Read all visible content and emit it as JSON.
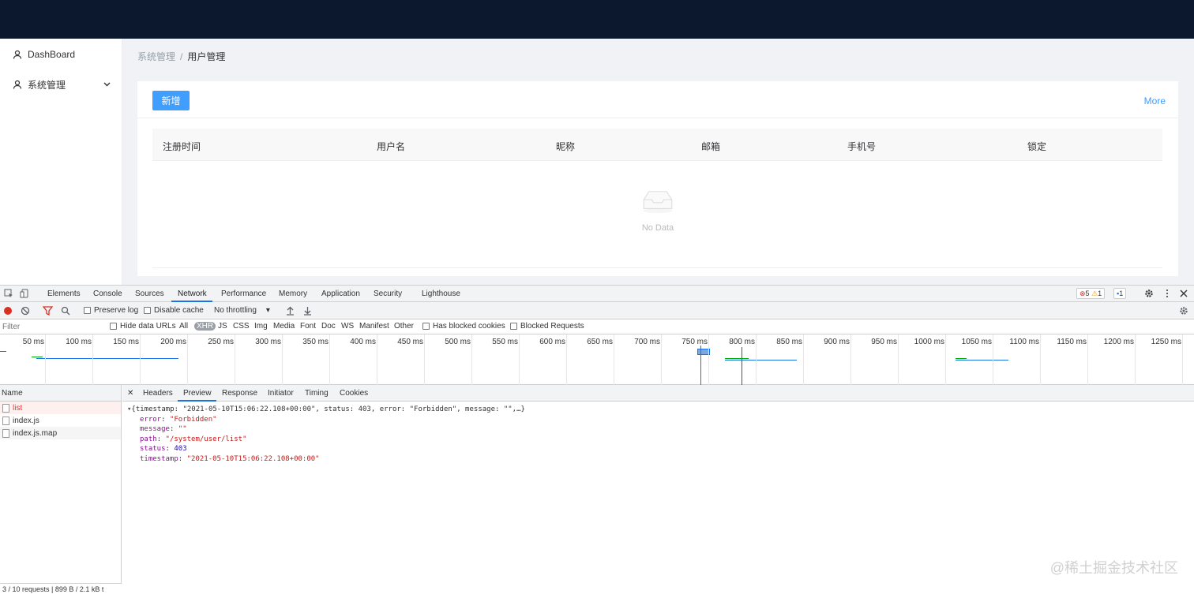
{
  "sidebar": {
    "items": [
      {
        "label": "DashBoard",
        "icon": "user-icon"
      },
      {
        "label": "系统管理",
        "icon": "user-icon",
        "chevron": "chevron-down-icon"
      }
    ]
  },
  "breadcrumb": {
    "parent": "系统管理",
    "separator": "/",
    "current": "用户管理"
  },
  "card": {
    "add_button": "新增",
    "more_link": "More",
    "columns": [
      "注册时间",
      "用户名",
      "昵称",
      "邮箱",
      "手机号",
      "锁定"
    ],
    "empty_text": "No Data"
  },
  "devtools": {
    "tabs": [
      "Elements",
      "Console",
      "Sources",
      "Network",
      "Performance",
      "Memory",
      "Application",
      "Security",
      "Lighthouse"
    ],
    "active_tab": "Network",
    "badges": {
      "errors": "5",
      "warnings": "1",
      "messages": "1"
    },
    "toolbar": {
      "preserve_log": "Preserve log",
      "disable_cache": "Disable cache",
      "throttling": "No throttling"
    },
    "filter": {
      "placeholder": "Filter",
      "hide_data_urls": "Hide data URLs",
      "types": [
        "All",
        "XHR",
        "JS",
        "CSS",
        "Img",
        "Media",
        "Font",
        "Doc",
        "WS",
        "Manifest",
        "Other"
      ],
      "selected_type": "XHR",
      "blocked_cookies": "Has blocked cookies",
      "blocked_requests": "Blocked Requests"
    },
    "timeline_ticks": [
      "50 ms",
      "100 ms",
      "150 ms",
      "200 ms",
      "250 ms",
      "300 ms",
      "350 ms",
      "400 ms",
      "450 ms",
      "500 ms",
      "550 ms",
      "600 ms",
      "650 ms",
      "700 ms",
      "750 ms",
      "800 ms",
      "850 ms",
      "900 ms",
      "950 ms",
      "1000 ms",
      "1050 ms",
      "1100 ms",
      "1150 ms",
      "1200 ms",
      "1250 ms"
    ],
    "requests_header": "Name",
    "requests": [
      "list",
      "index.js",
      "index.js.map"
    ],
    "status_bar": "3 / 10 requests | 899 B / 2.1 kB t",
    "detail_tabs": [
      "Headers",
      "Preview",
      "Response",
      "Initiator",
      "Timing",
      "Cookies"
    ],
    "active_detail_tab": "Preview",
    "preview": {
      "summary": "{timestamp: \"2021-05-10T15:06:22.108+00:00\", status: 403, error: \"Forbidden\", message: \"\",…}",
      "fields": [
        {
          "key": "error",
          "value": "\"Forbidden\"",
          "kind": "str"
        },
        {
          "key": "message",
          "value": "\"\"",
          "kind": "str"
        },
        {
          "key": "path",
          "value": "\"/system/user/list\"",
          "kind": "str"
        },
        {
          "key": "status",
          "value": "403",
          "kind": "num"
        },
        {
          "key": "timestamp",
          "value": "\"2021-05-10T15:06:22.108+00:00\"",
          "kind": "str"
        }
      ]
    }
  },
  "watermark": "@稀土掘金技术社区"
}
